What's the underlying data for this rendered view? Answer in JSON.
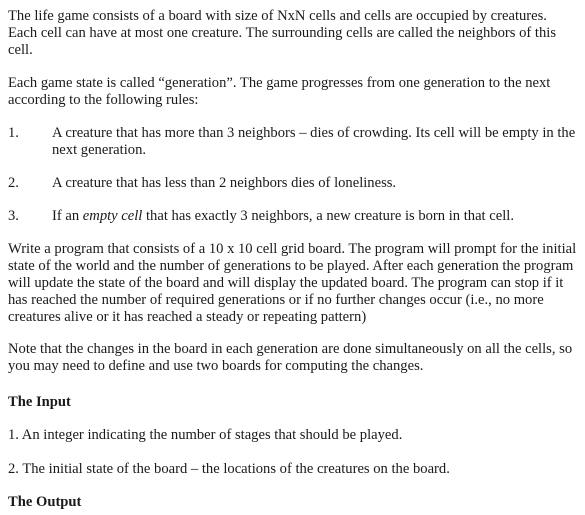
{
  "document": {
    "intro_paragraph": "The life game consists of a board with size of NxN cells and cells are occupied by creatures. Each cell can have at most one creature. The surrounding cells are called the neighbors of this cell.",
    "intro_lines": [
      "The life game consists of a board with size of NxN cells and cells are occupied by creatures.",
      "Each cell can have at most one creature. The surrounding cells are called the neighbors of this",
      "cell."
    ],
    "generation_lines": [
      "Each game state is called “generation”. The game progresses from one generation to the next",
      "according to the following rules:"
    ],
    "rules": [
      {
        "number": "1.",
        "lines": [
          "A creature that has more than 3 neighbors – dies of crowding. Its cell will be empty in the",
          "next generation."
        ]
      },
      {
        "number": "2.",
        "lines": [
          "A creature that has less than 2 neighbors dies of loneliness."
        ]
      },
      {
        "number": "3.",
        "prefix": "If an ",
        "emphasis": "empty cell",
        "suffix": " that has exactly 3 neighbors, a new creature is born in that cell."
      }
    ],
    "program_lines": [
      "Write a program that consists of a 10 x 10 cell grid board. The program will prompt for the initial",
      "state of the world and the number of generations to be played. After each generation the program",
      "will update the state of the board and will display the updated board. The program can stop if it",
      "has reached the number of required generations or if no further changes occur (i.e., no more",
      "creatures alive or it has reached a steady or repeating pattern)"
    ],
    "note_lines": [
      "Note that the changes in the board in each generation are done simultaneously on all the cells, so",
      "you may need to define and use two boards for computing the changes."
    ],
    "input_heading": "The Input",
    "input_items": [
      "1. An integer indicating the number of stages that should be played.",
      "2. The initial state of the board – the locations of the creatures on the board."
    ],
    "output_heading": "The Output"
  }
}
